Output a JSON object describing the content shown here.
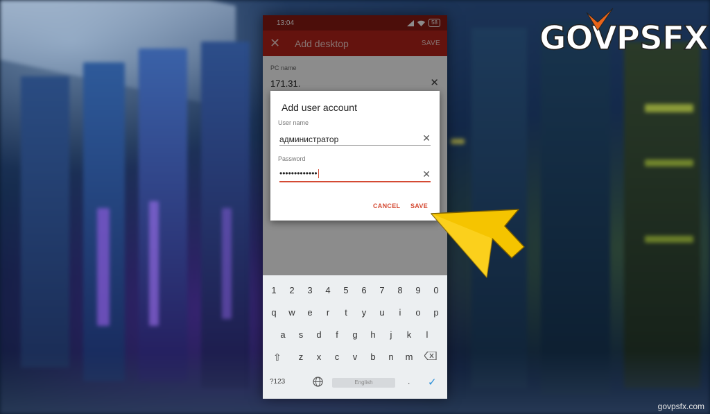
{
  "status_bar": {
    "time": "13:04",
    "battery": "58"
  },
  "app_bar": {
    "title": "Add desktop",
    "close_icon": "close-icon",
    "save_label": "SAVE"
  },
  "form": {
    "pc_name_label": "PC name",
    "pc_name_value": "171.31."
  },
  "dialog": {
    "title": "Add user account",
    "username_label": "User name",
    "username_value": "администратор",
    "password_label": "Password",
    "password_value": "•••••••••••••",
    "cancel_label": "CANCEL",
    "save_label": "SAVE"
  },
  "keyboard": {
    "row1": [
      "1",
      "2",
      "3",
      "4",
      "5",
      "6",
      "7",
      "8",
      "9",
      "0"
    ],
    "row2": [
      "q",
      "w",
      "e",
      "r",
      "t",
      "y",
      "u",
      "i",
      "o",
      "p"
    ],
    "row3": [
      "a",
      "s",
      "d",
      "f",
      "g",
      "h",
      "j",
      "k",
      "l"
    ],
    "row4": [
      "z",
      "x",
      "c",
      "v",
      "b",
      "n",
      "m"
    ],
    "symbols_label": "?123",
    "space_label": "English",
    "period": ".",
    "shift_icon": "shift-icon",
    "backspace_icon": "backspace-icon",
    "globe_icon": "globe-icon",
    "enter_icon": "checkmark-icon"
  },
  "branding": {
    "logo_text": "GOVPSFX",
    "watermark": "govpsfx.com"
  },
  "colors": {
    "app_bar": "#b7241a",
    "status_bar": "#8a1a13",
    "accent": "#d44a33",
    "arrow": "#f5c400"
  }
}
